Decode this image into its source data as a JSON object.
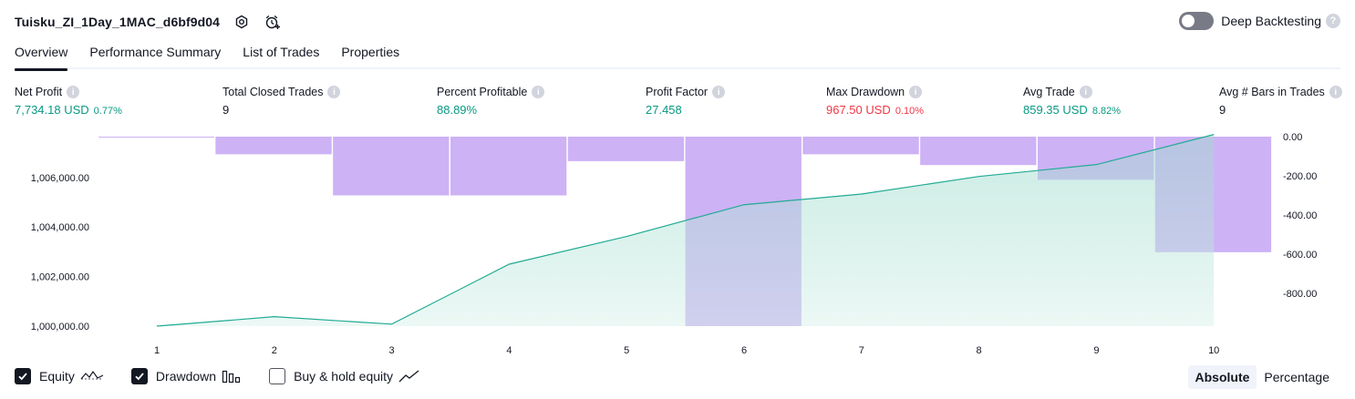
{
  "header": {
    "title": "Tuisku_ZI_1Day_1MAC_d6bf9d04"
  },
  "deep_backtesting": {
    "label": "Deep Backtesting",
    "enabled": false
  },
  "tabs": [
    {
      "label": "Overview",
      "active": true
    },
    {
      "label": "Performance Summary",
      "active": false
    },
    {
      "label": "List of Trades",
      "active": false
    },
    {
      "label": "Properties",
      "active": false
    }
  ],
  "metrics": {
    "net_profit": {
      "label": "Net Profit",
      "value": "7,734.18 USD",
      "sub": "0.77%"
    },
    "total_closed_trades": {
      "label": "Total Closed Trades",
      "value": "9"
    },
    "percent_profitable": {
      "label": "Percent Profitable",
      "value": "88.89%"
    },
    "profit_factor": {
      "label": "Profit Factor",
      "value": "27.458"
    },
    "max_drawdown": {
      "label": "Max Drawdown",
      "value": "967.50 USD",
      "sub": "0.10%"
    },
    "avg_trade": {
      "label": "Avg Trade",
      "value": "859.35 USD",
      "sub": "8.82%"
    },
    "avg_bars": {
      "label": "Avg # Bars in Trades",
      "value": "9"
    }
  },
  "chart_data": {
    "type": "area",
    "x": [
      1,
      2,
      3,
      4,
      5,
      6,
      7,
      8,
      9,
      10
    ],
    "series": [
      {
        "name": "Equity",
        "axis": "left",
        "values": [
          1000000,
          1000380,
          1000080,
          1002500,
          1003620,
          1004900,
          1005330,
          1006040,
          1006520,
          1007734
        ]
      },
      {
        "name": "Drawdown",
        "axis": "right",
        "type": "bar",
        "values": [
          0,
          -90,
          -300,
          -300,
          -125,
          -967.5,
          -90,
          -145,
          -220,
          -590
        ]
      }
    ],
    "left_ticks": [
      "1,000,000.00",
      "1,002,000.00",
      "1,004,000.00",
      "1,006,000.00"
    ],
    "right_ticks": [
      "0.00",
      "-200.00",
      "-400.00",
      "-600.00",
      "-800.00"
    ],
    "x_ticks": [
      "1",
      "2",
      "3",
      "4",
      "5",
      "6",
      "7",
      "8",
      "9",
      "10"
    ],
    "left_ylim": [
      1000000,
      1006000
    ],
    "right_ylim": [
      -967.5,
      0
    ]
  },
  "legend": {
    "equity": {
      "label": "Equity",
      "checked": true
    },
    "drawdown": {
      "label": "Drawdown",
      "checked": true
    },
    "buy_hold": {
      "label": "Buy & hold equity",
      "checked": false
    }
  },
  "mode": {
    "absolute": "Absolute",
    "percentage": "Percentage",
    "selected": "Absolute"
  },
  "colors": {
    "equity_line": "#22ab94",
    "equity_fill": "#c8ebe3",
    "drawdown_bar": "#e1bffe",
    "profit": "#089981",
    "loss": "#f23645"
  }
}
